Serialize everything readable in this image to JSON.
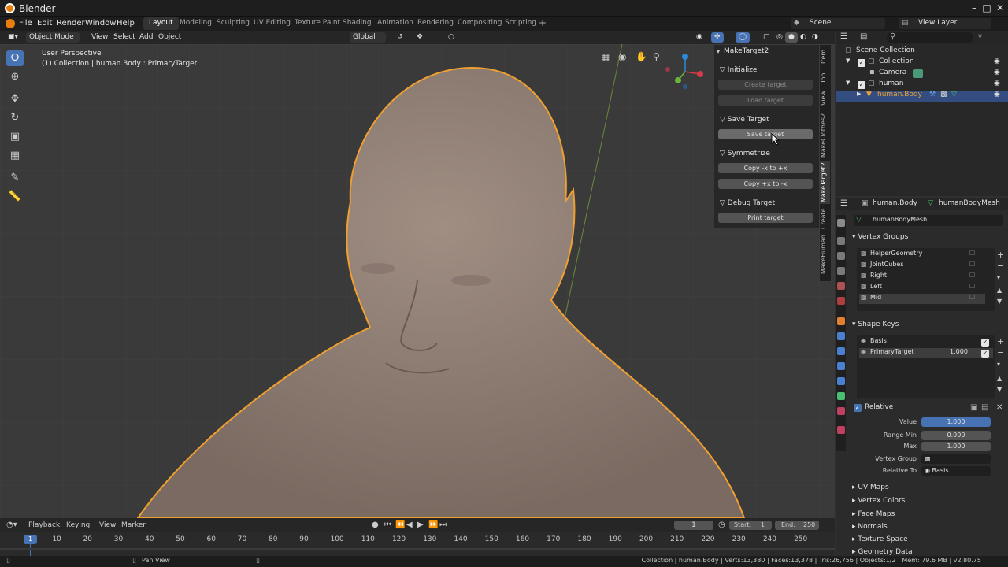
{
  "title": "Blender",
  "menus": [
    "File",
    "Edit",
    "Render",
    "Window",
    "Help"
  ],
  "workspaces": [
    "Layout",
    "Modeling",
    "Sculpting",
    "UV Editing",
    "Texture Paint",
    "Shading",
    "Animation",
    "Rendering",
    "Compositing",
    "Scripting"
  ],
  "active_workspace": "Layout",
  "scene": "Scene",
  "view_layer": "View Layer",
  "header": {
    "mode": "Object Mode",
    "view": "View",
    "select": "Select",
    "add": "Add",
    "object": "Object",
    "orientation": "Global"
  },
  "viewport": {
    "perspective": "User Perspective",
    "collection_info": "(1) Collection | human.Body : PrimaryTarget"
  },
  "npanel": {
    "title": "MakeTarget2",
    "initialize": "Initialize",
    "create_target": "Create target",
    "load_target": "Load target",
    "save_section": "Save Target",
    "save_target": "Save target",
    "symmetrize": "Symmetrize",
    "copy_neg_pos": "Copy -x to +x",
    "copy_pos_neg": "Copy +x to -x",
    "debug": "Debug Target",
    "print_target": "Print target",
    "tabs": [
      "Item",
      "Tool",
      "View",
      "MakeClothes2",
      "MakeTarget2",
      "Create",
      "MakeHuman"
    ]
  },
  "outliner": {
    "scene_collection": "Scene Collection",
    "collection": "Collection",
    "camera": "Camera",
    "human": "human",
    "body": "human.Body"
  },
  "properties": {
    "object": "human.Body",
    "mesh": "humanBodyMesh",
    "mesh_field": "humanBodyMesh",
    "vertex_groups_title": "Vertex Groups",
    "vertex_groups": [
      "HelperGeometry",
      "JointCubes",
      "Right",
      "Left",
      "Mid"
    ],
    "shape_keys_title": "Shape Keys",
    "shape_keys": [
      {
        "name": "Basis",
        "value": ""
      },
      {
        "name": "PrimaryTarget",
        "value": "1.000"
      }
    ],
    "relative": "Relative",
    "value_label": "Value",
    "value": "1.000",
    "range_min_label": "Range Min",
    "range_min": "0.000",
    "max_label": "Max",
    "max": "1.000",
    "vertex_group_label": "Vertex Group",
    "relative_to_label": "Relative To",
    "relative_to": "Basis",
    "more_sections": [
      "UV Maps",
      "Vertex Colors",
      "Face Maps",
      "Normals",
      "Texture Space",
      "Geometry Data"
    ]
  },
  "timeline": {
    "playback": "Playback",
    "keying": "Keying",
    "view": "View",
    "marker": "Marker",
    "current_frame": "1",
    "start_label": "Start:",
    "start": "1",
    "end_label": "End:",
    "end": "250",
    "ticks": [
      "10",
      "20",
      "30",
      "40",
      "50",
      "60",
      "70",
      "80",
      "90",
      "100",
      "110",
      "120",
      "130",
      "140",
      "150",
      "160",
      "170",
      "180",
      "190",
      "200",
      "210",
      "220",
      "230",
      "240",
      "250"
    ],
    "cursor": "1"
  },
  "status": {
    "hint": "Pan View",
    "info": "Collection | human.Body | Verts:13,380 | Faces:13,378 | Tris:26,756 | Objects:1/2 | Mem: 79.6 MB | v2.80.75"
  }
}
